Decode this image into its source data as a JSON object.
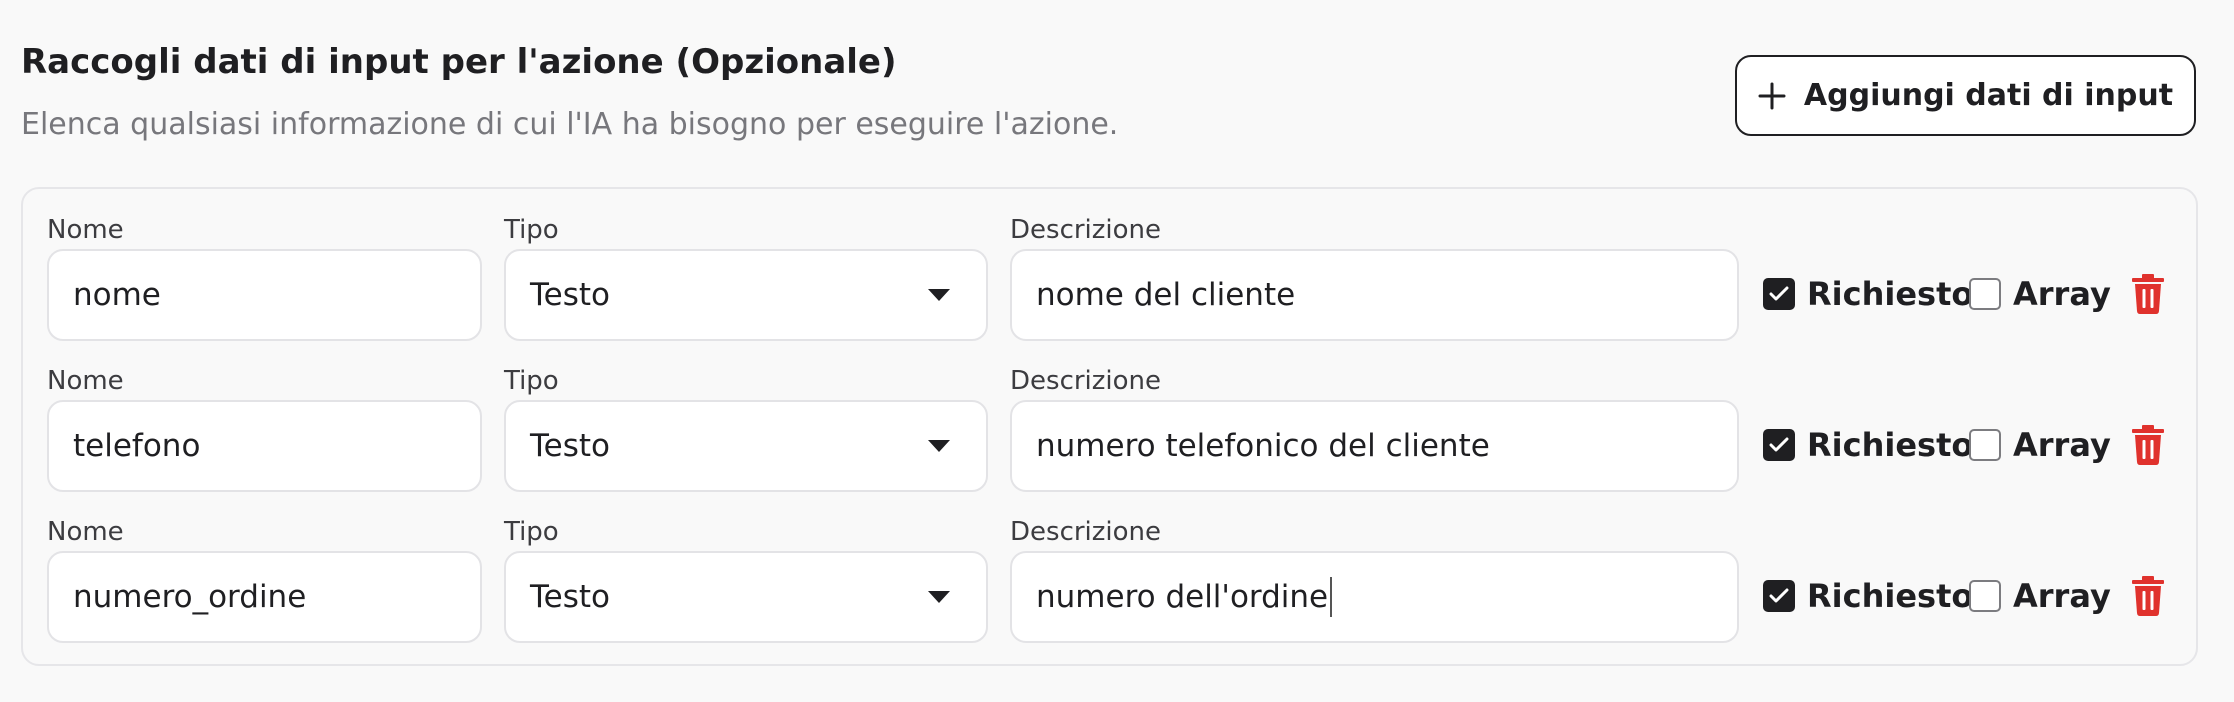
{
  "header": {
    "title": "Raccogli dati di input per l'azione (Opzionale)",
    "subtitle": "Elenca qualsiasi informazione di cui l'IA ha bisogno per eseguire l'azione.",
    "add_button_label": "Aggiungi dati di input",
    "add_button_icon": "plus-icon"
  },
  "colors": {
    "delete_icon": "#e0322d",
    "checkbox_checked": "#1f1f22",
    "border": "#e3e3e6",
    "muted_text": "#77777c"
  },
  "rows": [
    {
      "name_label": "Nome",
      "name_value": "nome",
      "type_label": "Tipo",
      "type_value": "Testo",
      "description_label": "Descrizione",
      "description_value": "nome del cliente",
      "required_label": "Richiesto",
      "required_checked": true,
      "array_label": "Array",
      "array_checked": false,
      "delete_icon": "trash-icon"
    },
    {
      "name_label": "Nome",
      "name_value": "telefono",
      "type_label": "Tipo",
      "type_value": "Testo",
      "description_label": "Descrizione",
      "description_value": "numero telefonico del cliente",
      "required_label": "Richiesto",
      "required_checked": true,
      "array_label": "Array",
      "array_checked": false,
      "delete_icon": "trash-icon"
    },
    {
      "name_label": "Nome",
      "name_value": "numero_ordine",
      "type_label": "Tipo",
      "type_value": "Testo",
      "description_label": "Descrizione",
      "description_value": "numero dell'ordine",
      "required_label": "Richiesto",
      "required_checked": true,
      "array_label": "Array",
      "array_checked": false,
      "delete_icon": "trash-icon"
    }
  ]
}
